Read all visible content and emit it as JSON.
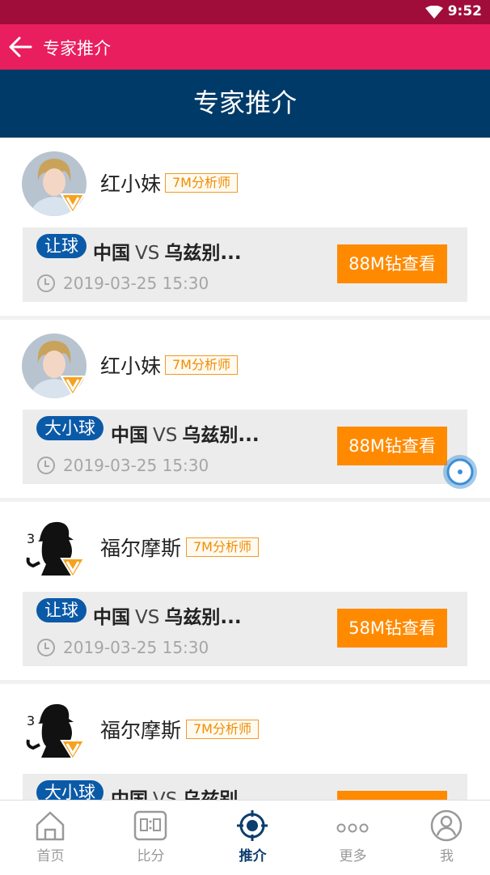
{
  "status_bar": {
    "time": "9:52"
  },
  "app_bar": {
    "title": "专家推介"
  },
  "banner": {
    "title": "专家推介"
  },
  "cards": [
    {
      "name": "红小妹",
      "tag": "7M分析师",
      "pill": "让球",
      "team_home": "中国",
      "vs": "VS",
      "team_away": "乌兹别...",
      "date": "2019-03-25 15:30",
      "button": "88M钻查看",
      "avatar": "woman-avatar"
    },
    {
      "name": "红小妹",
      "tag": "7M分析师",
      "pill": "大小球",
      "team_home": "中国",
      "vs": "VS",
      "team_away": "乌兹别...",
      "date": "2019-03-25 15:30",
      "button": "88M钻查看",
      "avatar": "woman-avatar"
    },
    {
      "name": "福尔摩斯",
      "tag": "7M分析师",
      "pill": "让球",
      "team_home": "中国",
      "vs": "VS",
      "team_away": "乌兹别...",
      "date": "2019-03-25 15:30",
      "button": "58M钻查看",
      "avatar": "detective-avatar"
    },
    {
      "name": "福尔摩斯",
      "tag": "7M分析师",
      "pill": "大小球",
      "team_home": "中国",
      "vs": "VS",
      "team_away": "乌兹别",
      "date": "",
      "button": "",
      "avatar": "detective-avatar"
    }
  ],
  "tabs": [
    {
      "label": "首页",
      "icon": "home-icon"
    },
    {
      "label": "比分",
      "icon": "scoreboard-icon"
    },
    {
      "label": "推介",
      "icon": "target-icon",
      "active": true
    },
    {
      "label": "更多",
      "icon": "more-icon"
    },
    {
      "label": "我",
      "icon": "user-icon"
    }
  ],
  "colors": {
    "status_bar": "#a00d3b",
    "app_bar": "#e91e5e",
    "banner": "#003a68",
    "pill": "#0b5aa8",
    "button": "#ff8a00",
    "tag": "#f08c00",
    "tab_active": "#0c3d6d"
  }
}
